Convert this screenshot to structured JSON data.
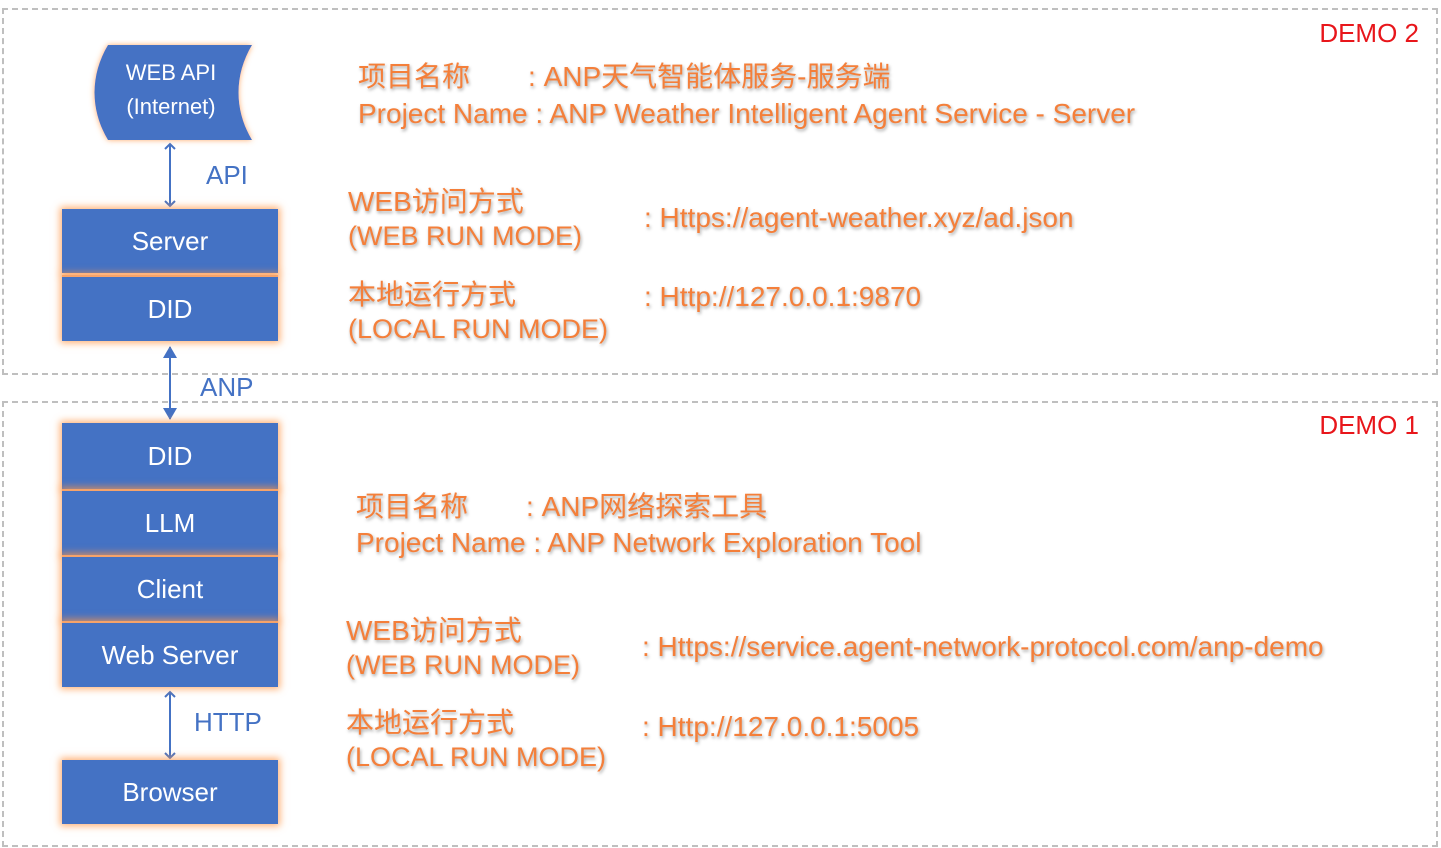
{
  "demo2": {
    "tag": "DEMO 2",
    "web_api_line1": "WEB API",
    "web_api_line2": "(Internet)",
    "api_label": "API",
    "blocks": [
      "Server",
      "DID"
    ],
    "project_name_cn": "项目名称",
    "project_name_cn_value": ": ANP天气智能体服务-服务端",
    "project_name_en": "Project Name",
    "project_name_en_value": ": ANP Weather Intelligent Agent Service - Server",
    "web_mode_cn": "WEB访问方式",
    "web_mode_en": "(WEB RUN MODE)",
    "web_mode_value": ": Https://agent-weather.xyz/ad.json",
    "local_mode_cn": "本地运行方式",
    "local_mode_en": "(LOCAL RUN MODE)",
    "local_mode_value": ": Http://127.0.0.1:9870"
  },
  "anp_label": "ANP",
  "demo1": {
    "tag": "DEMO 1",
    "blocks": [
      "DID",
      "LLM",
      "Client",
      "Web Server"
    ],
    "http_label": "HTTP",
    "browser": "Browser",
    "project_name_cn": "项目名称",
    "project_name_cn_value": ": ANP网络探索工具",
    "project_name_en": "Project Name",
    "project_name_en_value": ": ANP Network Exploration Tool",
    "web_mode_cn": "WEB访问方式",
    "web_mode_en": "(WEB RUN MODE)",
    "web_mode_value": ": Https://service.agent-network-protocol.com/anp-demo",
    "local_mode_cn": "本地运行方式",
    "local_mode_en": "(LOCAL RUN MODE)",
    "local_mode_value": ": Http://127.0.0.1:5005"
  },
  "colors": {
    "block_fill": "#4472c4",
    "block_glow": "#ff9646",
    "info_text": "#f47f3a",
    "demo_tag": "#e8161b",
    "connector": "#4472c4",
    "dashed_border": "#bfbfbf"
  }
}
